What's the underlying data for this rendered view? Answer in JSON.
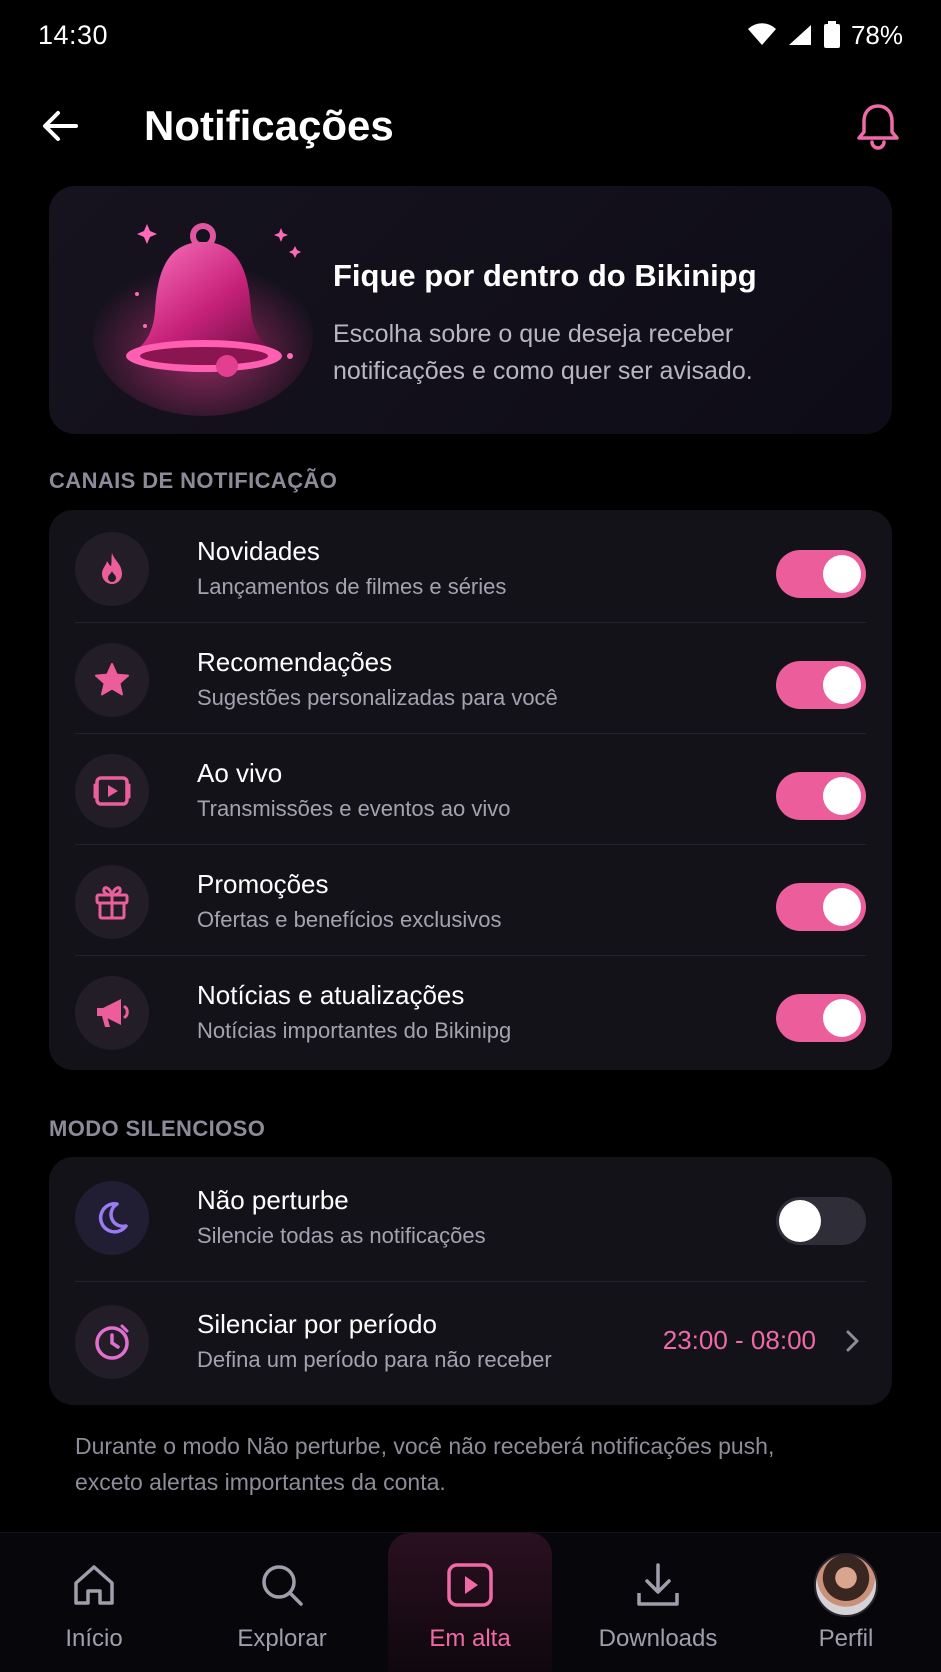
{
  "status_bar": {
    "time": "14:30",
    "battery": "78%"
  },
  "header": {
    "title": "Notificações"
  },
  "hero": {
    "title": "Fique por dentro do Bikinipg",
    "text": "Escolha sobre o que deseja receber notificações e como quer ser avisado."
  },
  "channels": {
    "label": "CANAIS DE NOTIFICAÇÃO",
    "items": [
      {
        "title": "Novidades",
        "subtitle": "Lançamentos de filmes e séries",
        "icon": "flame-icon",
        "enabled": true
      },
      {
        "title": "Recomendações",
        "subtitle": "Sugestões personalizadas para você",
        "icon": "star-icon",
        "enabled": true
      },
      {
        "title": "Ao vivo",
        "subtitle": "Transmissões e eventos ao vivo",
        "icon": "live-video-icon",
        "enabled": true
      },
      {
        "title": "Promoções",
        "subtitle": "Ofertas e benefícios exclusivos",
        "icon": "gift-icon",
        "enabled": true
      },
      {
        "title": "Notícias e atualizações",
        "subtitle": "Notícias importantes do Bikinipg",
        "icon": "megaphone-icon",
        "enabled": true
      }
    ]
  },
  "silent": {
    "label": "MODO SILENCIOSO",
    "dnd": {
      "title": "Não perturbe",
      "subtitle": "Silencie todas as notificações",
      "icon": "moon-icon",
      "enabled": false
    },
    "period": {
      "title": "Silenciar por período",
      "subtitle": "Defina um período para não receber",
      "icon": "clock-icon",
      "value": "23:00 - 08:00"
    }
  },
  "footnote": "Durante o modo Não perturbe, você não receberá notificações push, exceto alertas importantes da conta.",
  "bottom_nav": [
    {
      "label": "Início",
      "icon": "home-icon",
      "active": false
    },
    {
      "label": "Explorar",
      "icon": "search-icon",
      "active": false
    },
    {
      "label": "Em alta",
      "icon": "play-icon",
      "active": true
    },
    {
      "label": "Downloads",
      "icon": "download-icon",
      "active": false
    },
    {
      "label": "Perfil",
      "icon": "avatar",
      "active": false
    }
  ],
  "colors": {
    "accent": "#ec5d9c",
    "accent_text": "#f06aa8",
    "background": "#000000",
    "card": "#131219",
    "moon_purple": "#9b7cf0"
  }
}
